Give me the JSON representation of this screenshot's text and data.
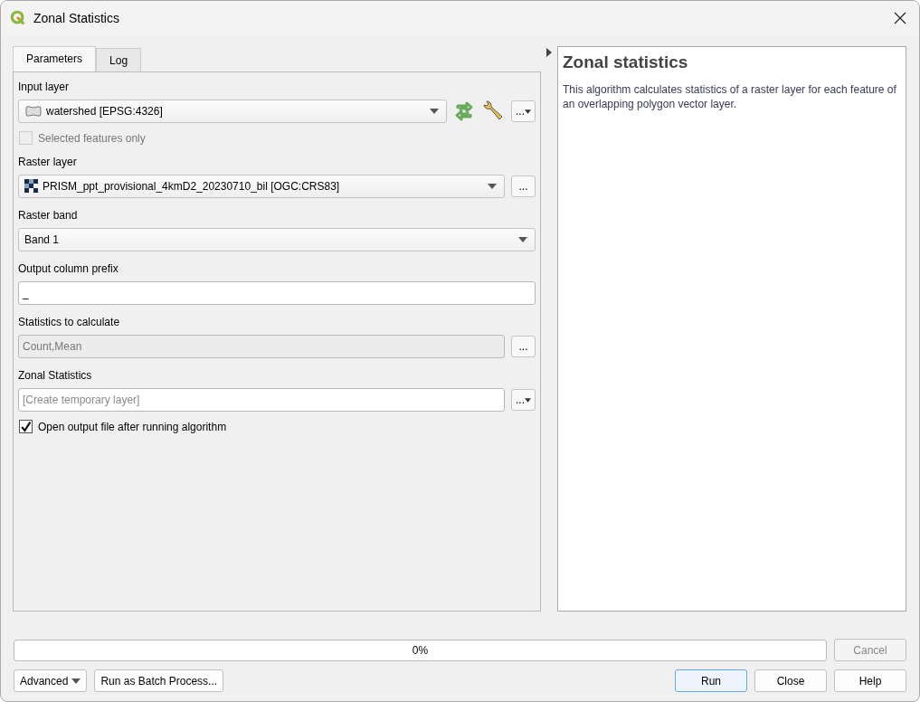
{
  "window": {
    "title": "Zonal Statistics"
  },
  "tabs": [
    {
      "label": "Parameters",
      "selected": true
    },
    {
      "label": "Log",
      "selected": false
    }
  ],
  "params": [
    {
      "kind": "vector_combo",
      "label": "Input layer",
      "value": "watershed [EPSG:4326]",
      "tools": true,
      "browse": "...",
      "browse_menu": true
    },
    {
      "kind": "checkbox",
      "label": "Selected features only",
      "checked": false,
      "disabled": true
    },
    {
      "kind": "raster_combo",
      "label": "Raster layer",
      "value": "PRISM_ppt_provisional_4kmD2_20230710_bil [OGC:CRS83]",
      "tools": false,
      "browse": "...",
      "browse_menu": false
    },
    {
      "kind": "combo",
      "label": "Raster band",
      "value": "Band 1",
      "tools": false
    },
    {
      "kind": "text",
      "label": "Output column prefix",
      "value": "_",
      "disabled": false
    },
    {
      "kind": "text",
      "label": "Statistics to calculate",
      "value": "Count,Mean",
      "disabled": true,
      "browse": "...",
      "browse_menu": false
    },
    {
      "kind": "text",
      "label": "Zonal Statistics",
      "placeholder": "[Create temporary layer]",
      "disabled": false,
      "browse": "...",
      "browse_menu": true
    },
    {
      "kind": "checkbox",
      "label": "Open output file after running algorithm",
      "checked": true,
      "disabled": false
    }
  ],
  "help": {
    "title": "Zonal statistics",
    "text": "This algorithm calculates statistics of a raster layer for each feature of an overlapping polygon vector layer."
  },
  "progress": {
    "level": 0,
    "reading": "0%"
  },
  "buttons": [
    {
      "label": "Cancel",
      "kind": "cancel",
      "disabled": true
    },
    {
      "label": "Advanced",
      "kind": "menu",
      "disabled": false
    },
    {
      "label": "Run as Batch Process...",
      "kind": "left",
      "disabled": false
    },
    {
      "label": "Run",
      "kind": "default",
      "disabled": false
    },
    {
      "label": "Close",
      "kind": "right",
      "disabled": false
    },
    {
      "label": "Help",
      "kind": "right",
      "disabled": false
    }
  ]
}
